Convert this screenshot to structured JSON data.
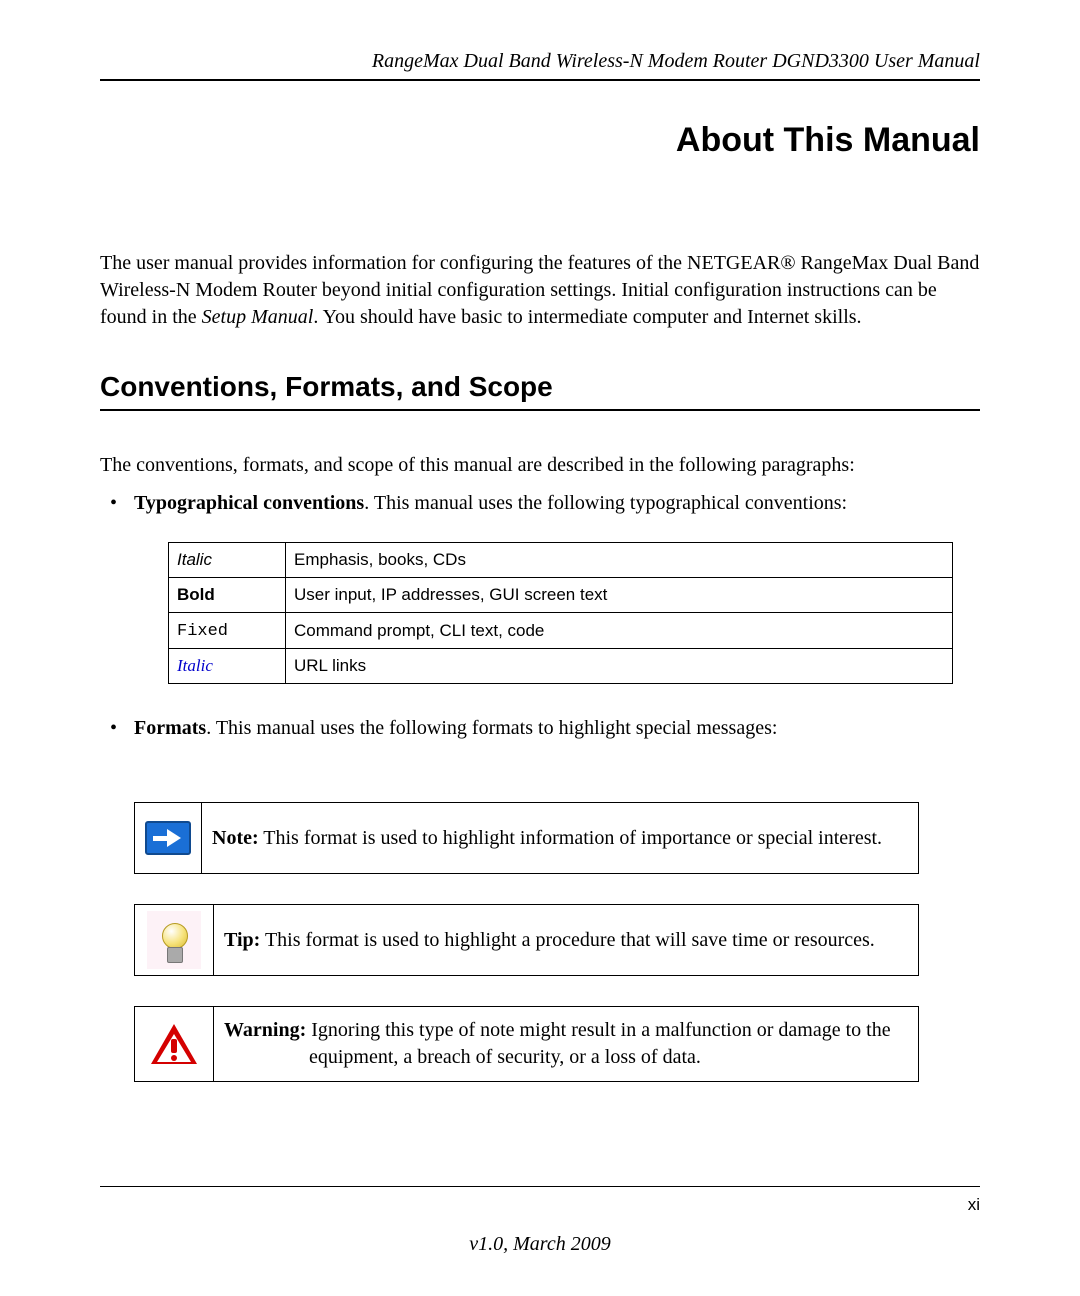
{
  "header": "RangeMax Dual Band Wireless-N Modem Router DGND3300 User Manual",
  "chapter_title": "About This Manual",
  "intro_pre": "The user manual provides information for configuring the features of the NETGEAR® RangeMax Dual Band Wireless-N Modem Router beyond initial configuration settings. Initial configuration instructions can be found in the ",
  "intro_em": "Setup Manual",
  "intro_post": ". You should have basic to intermediate computer and Internet skills.",
  "section_heading": "Conventions, Formats, and Scope",
  "conv_intro": "The conventions, formats, and scope of this manual are described in the following paragraphs:",
  "bullets": {
    "typo": {
      "label": "Typographical conventions",
      "rest": ". This manual uses the following typographical conventions:"
    },
    "formats": {
      "label": "Formats",
      "rest": ". This manual uses the following formats to highlight special messages:"
    }
  },
  "conv_table": [
    {
      "style": "t-italic",
      "name": "Italic",
      "desc": "Emphasis, books, CDs"
    },
    {
      "style": "t-bold",
      "name": "Bold",
      "desc": "User input, IP addresses, GUI screen text"
    },
    {
      "style": "t-fixed",
      "name": "Fixed",
      "desc": "Command prompt, CLI text, code"
    },
    {
      "style": "t-link",
      "name": "Italic",
      "desc": "URL links"
    }
  ],
  "callouts": {
    "note": {
      "label": "Note:",
      "text": " This format is used to highlight information of importance or special interest."
    },
    "tip": {
      "label": "Tip:",
      "text": " This format is used to highlight a procedure that will save time or resources."
    },
    "warn": {
      "label": "Warning:",
      "text_line1": " Ignoring this type of note might result in a malfunction or damage to the",
      "text_line2": "equipment, a breach of security, or a loss of data."
    }
  },
  "page_number": "xi",
  "footer_version": "v1.0, March 2009"
}
